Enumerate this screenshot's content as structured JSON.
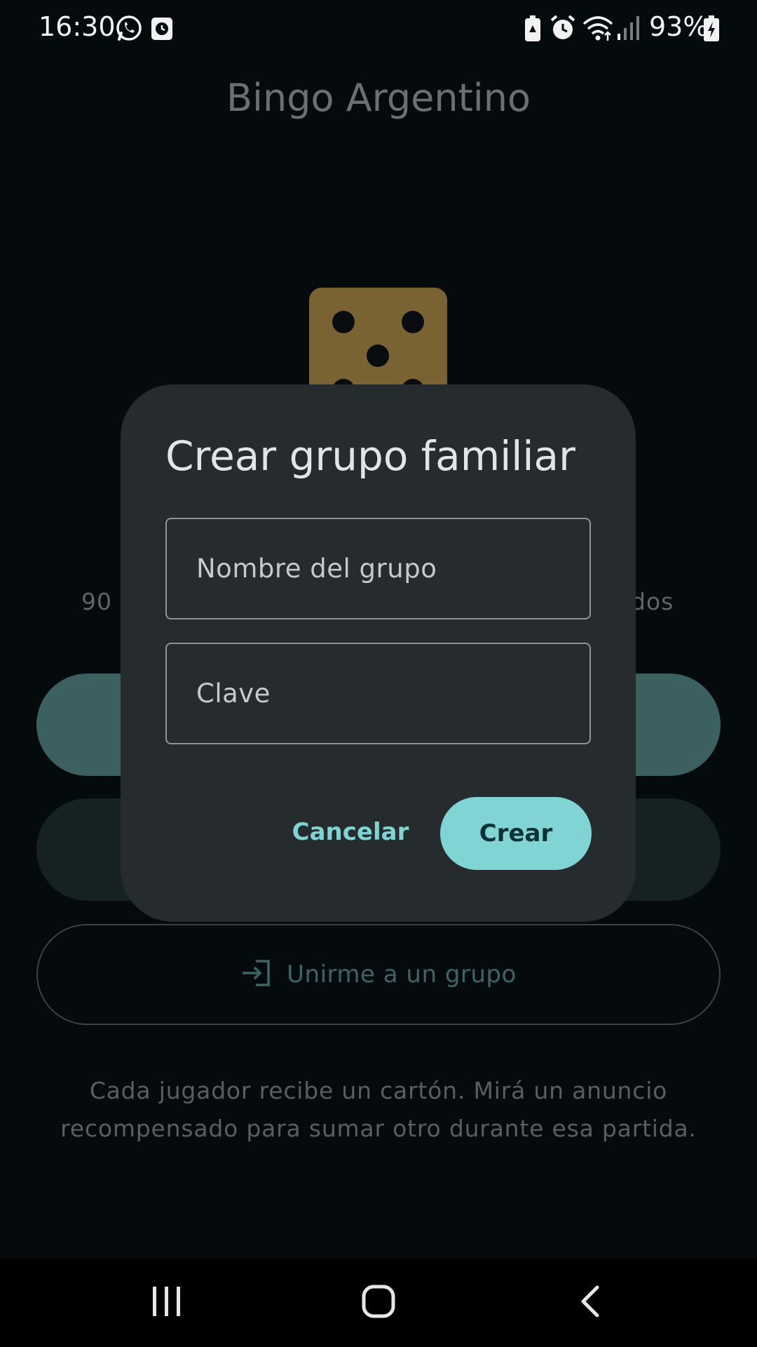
{
  "status_bar": {
    "time": "16:30",
    "battery": "93%",
    "left_icons": [
      "whatsapp-icon",
      "clock-app-icon"
    ],
    "right_icons": [
      "battery-saver-icon",
      "alarm-icon",
      "wifi-icon",
      "signal-icon",
      "battery-charging-icon"
    ]
  },
  "app": {
    "title": "Bingo Argentino",
    "logo_icon": "die-five-icon",
    "subtitle_fragment_left": "90 ",
    "subtitle_fragment_right": "dos",
    "join_button": {
      "icon": "login-icon",
      "label": "Unirme a un grupo"
    },
    "info_text": "Cada jugador recibe un cartón. Mirá un anuncio recompensado para sumar otro durante esa partida."
  },
  "dialog": {
    "title": "Crear grupo familiar",
    "group_name_placeholder": "Nombre del grupo",
    "group_name_value": "",
    "key_placeholder": "Clave",
    "key_value": "",
    "cancel_label": "Cancelar",
    "create_label": "Crear"
  },
  "colors": {
    "background": "#050b0d",
    "dialog_surface": "#262c2e",
    "accent": "#80d4d4",
    "die": "#7a6333"
  },
  "nav_bar": {
    "buttons": [
      "recent-apps-icon",
      "home-icon",
      "back-icon"
    ]
  }
}
